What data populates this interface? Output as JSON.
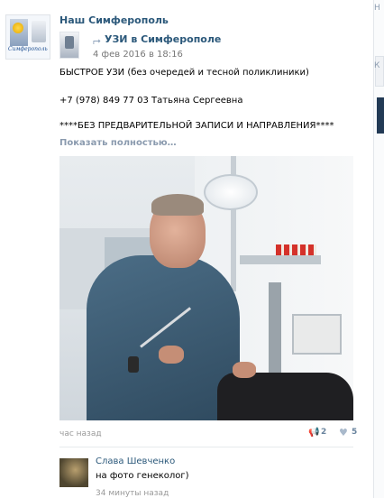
{
  "group": {
    "name": "Наш Симферополь",
    "avatar_brand": "Симферополь"
  },
  "repost": {
    "icon": "repost-arrow-icon",
    "name": "УЗИ в Симферополе",
    "date": "4 фев 2016 в 18:16"
  },
  "post": {
    "lines": [
      "БЫСТРОЕ УЗИ (без очередей и тесной поликлиники)",
      "+7 (978) 849 77 03 Татьяна Сергеевна",
      "****БЕЗ ПРЕДВАРИТЕЛЬНОЙ ЗАПИСИ И НАПРАВЛЕНИЯ****"
    ],
    "show_more": "Показать полностью…"
  },
  "footer": {
    "time_ago": "час назад",
    "share_icon": "share-icon",
    "share_count": "2",
    "like_icon": "heart-icon",
    "like_count": "5"
  },
  "comment": {
    "author": "Слава Шевченко",
    "text": "на фото генеколог)",
    "time": "34 минуты назад"
  },
  "sidebar_fragments": {
    "top": "Н",
    "mid": "К"
  },
  "colors": {
    "link": "#2b587a",
    "muted": "#999999",
    "action": "#6a849e"
  }
}
